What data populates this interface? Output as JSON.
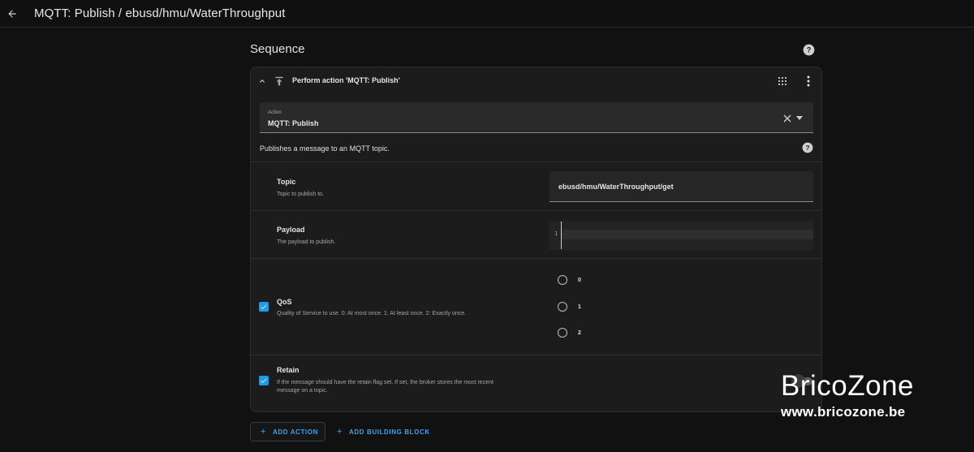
{
  "header": {
    "title": "MQTT: Publish / ebusd/hmu/WaterThroughput"
  },
  "sequence": {
    "title": "Sequence"
  },
  "action_card": {
    "title": "Perform action 'MQTT: Publish'",
    "action_label": "Action",
    "action_value": "MQTT: Publish",
    "description": "Publishes a message to an MQTT topic.",
    "fields": {
      "topic": {
        "title": "Topic",
        "subtitle": "Topic to publish to.",
        "value": "ebusd/hmu/WaterThroughput/get"
      },
      "payload": {
        "title": "Payload",
        "subtitle": "The payload to publish.",
        "line_number": "1",
        "value": ""
      },
      "qos": {
        "title": "QoS",
        "subtitle": "Quality of Service to use. 0: At most once. 1: At least once. 2: Exactly once.",
        "enabled": true,
        "options": [
          "0",
          "1",
          "2"
        ],
        "selected": null
      },
      "retain": {
        "title": "Retain",
        "subtitle_line1": "If the message should have the retain flag set. If set, the broker stores the most recent",
        "subtitle_line2": "message on a topic.",
        "enabled": true,
        "toggle_on": false
      }
    }
  },
  "buttons": {
    "add_action": "ADD ACTION",
    "add_building_block": "ADD BUILDING BLOCK"
  },
  "watermark": {
    "brand": "BricoZone",
    "url": "www.bricozone.be"
  },
  "colors": {
    "background": "#111111",
    "card": "#1c1c1c",
    "accent": "#1e9be9",
    "link": "#3ba4f0"
  }
}
